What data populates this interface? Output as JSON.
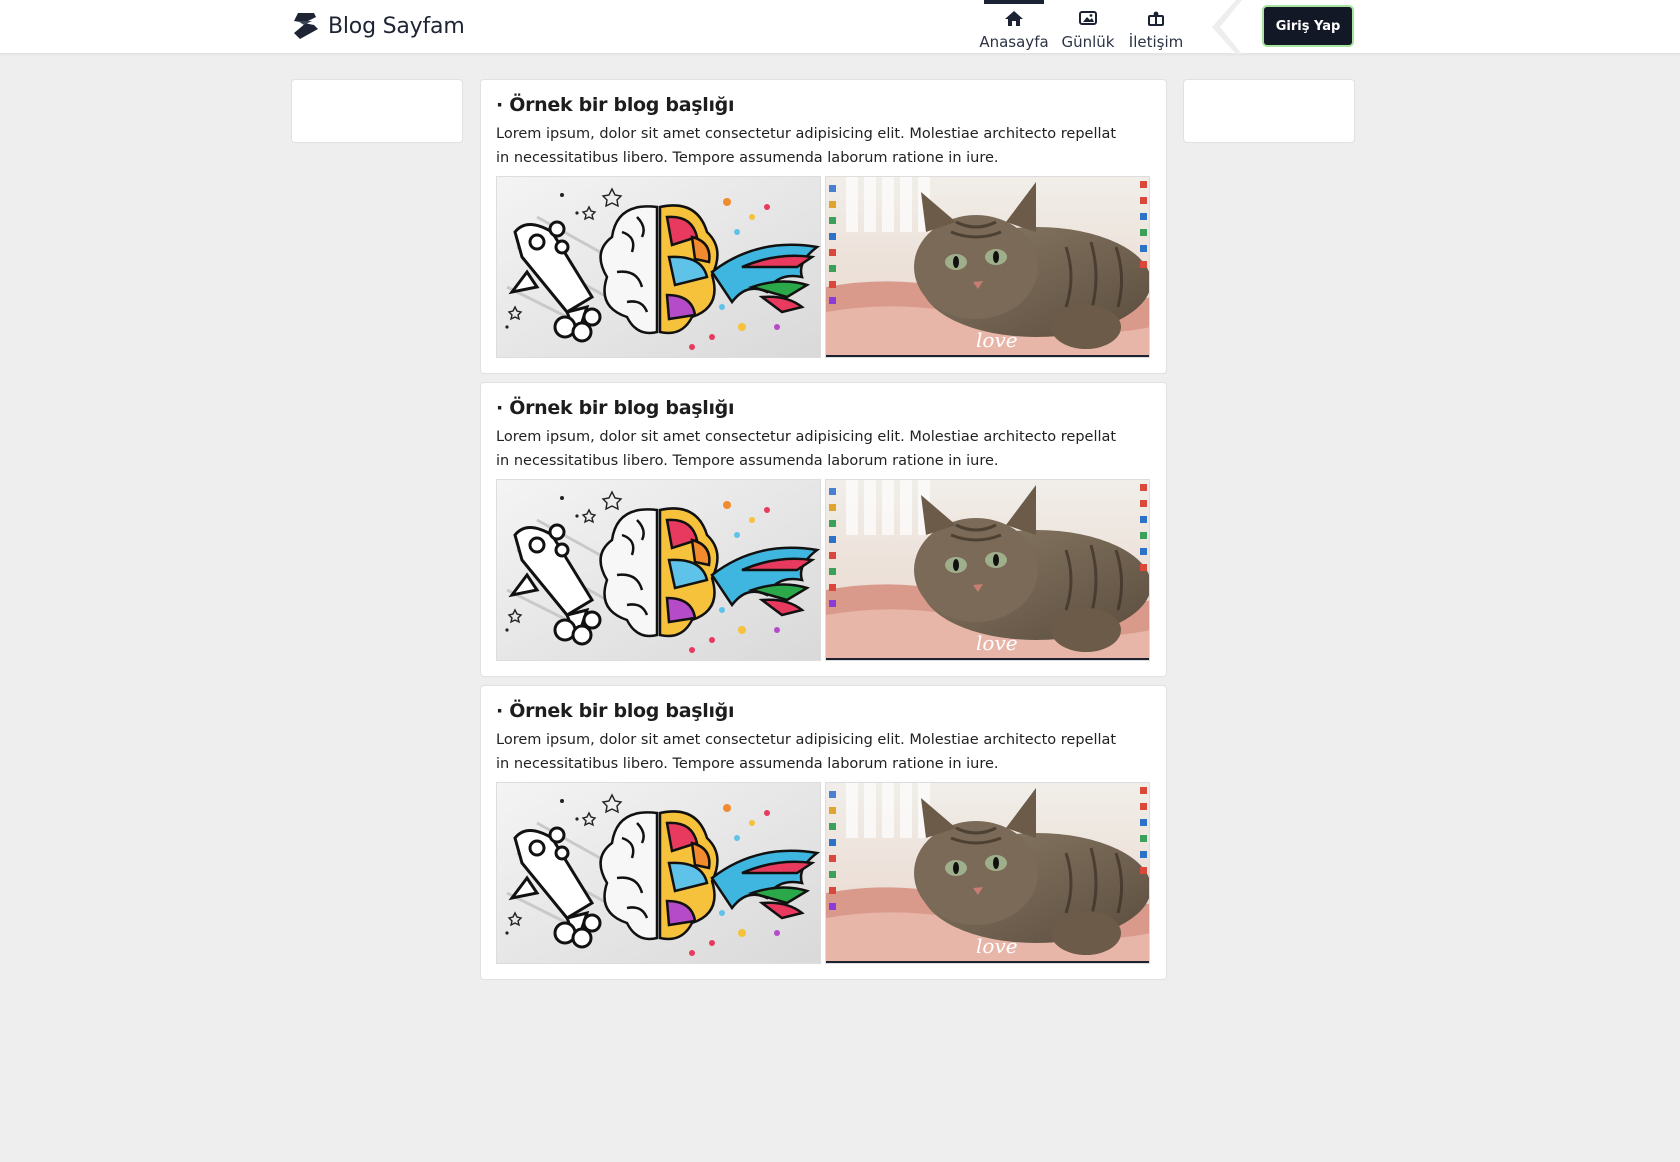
{
  "header": {
    "brand_title": "Blog Sayfam",
    "nav": [
      {
        "label": "Anasayfa",
        "icon": "home-icon",
        "active": true
      },
      {
        "label": "Günlük",
        "icon": "photo-icon",
        "active": false
      },
      {
        "label": "İletişim",
        "icon": "contact-icon",
        "active": false
      }
    ],
    "login_label": "Giriş Yap"
  },
  "posts": [
    {
      "title": "· Örnek bir blog başlığı",
      "body": "Lorem ipsum, dolor sit amet consectetur adipisicing elit. Molestiae architecto repellat in necessitatibus libero. Tempore assumenda laborum ratione in iure.",
      "images": [
        "brain-rocket-wings-illustration",
        "tabby-cat-desktop-screenshot"
      ],
      "cat_image_text": "love"
    },
    {
      "title": "· Örnek bir blog başlığı",
      "body": "Lorem ipsum, dolor sit amet consectetur adipisicing elit. Molestiae architecto repellat in necessitatibus libero. Tempore assumenda laborum ratione in iure.",
      "images": [
        "brain-rocket-wings-illustration",
        "tabby-cat-desktop-screenshot"
      ],
      "cat_image_text": "love"
    },
    {
      "title": "· Örnek bir blog başlığı",
      "body": "Lorem ipsum, dolor sit amet consectetur adipisicing elit. Molestiae architecto repellat in necessitatibus libero. Tempore assumenda laborum ratione in iure.",
      "images": [
        "brain-rocket-wings-illustration",
        "tabby-cat-desktop-screenshot"
      ],
      "cat_image_text": "love"
    }
  ],
  "colors": {
    "page_bg": "#eeeeee",
    "header_bg": "#ffffff",
    "brand_dark": "#1e2433",
    "login_bg": "#121826",
    "login_border": "#a9e4a0"
  }
}
